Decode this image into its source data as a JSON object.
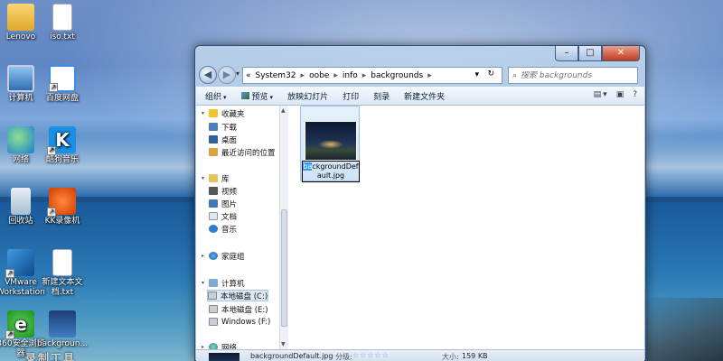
{
  "desktop": {
    "icons": [
      {
        "label": "Lenovo",
        "icon": "folder-icon"
      },
      {
        "label": "iso.txt",
        "icon": "text-file-icon"
      },
      {
        "label": "计算机",
        "icon": "computer-icon"
      },
      {
        "label": "百度网盘",
        "icon": "baidu-netdisk-icon"
      },
      {
        "label": "网络",
        "icon": "network-icon"
      },
      {
        "label": "酷狗音乐",
        "icon": "kugou-music-icon"
      },
      {
        "label": "回收站",
        "icon": "recycle-bin-icon"
      },
      {
        "label": "KK录像机",
        "icon": "kk-recorder-icon"
      },
      {
        "label": "VMware Workstation",
        "icon": "vmware-icon"
      },
      {
        "label": "新建文本文档.txt",
        "icon": "text-file-icon"
      },
      {
        "label": "360安全浏览器",
        "icon": "360-browser-icon"
      },
      {
        "label": "backgroun...",
        "icon": "image-file-icon"
      }
    ],
    "watermark": "录制工具"
  },
  "window": {
    "caption": {
      "minimize": "–",
      "maximize": "□",
      "close": "✕"
    },
    "nav": {
      "back": "◀",
      "forward": "▶",
      "dropdown": "▾"
    },
    "address": {
      "prefix": "«",
      "segments": [
        "System32",
        "oobe",
        "info",
        "backgrounds"
      ],
      "separator": "▸",
      "dropdown": "▾",
      "refresh": "↻"
    },
    "search": {
      "placeholder": "搜索 backgrounds",
      "icon": "⌕"
    },
    "toolbar": {
      "organize": "组织",
      "preview": "预览",
      "slideshow": "放映幻灯片",
      "print": "打印",
      "burn": "刻录",
      "new_folder": "新建文件夹",
      "arrow": "▾",
      "view_icon": "▤",
      "view_arrow": "▾",
      "preview_pane_icon": "▣",
      "help_icon": "?"
    },
    "navpane": {
      "favorites": {
        "label": "收藏夹",
        "items": [
          "下载",
          "桌面",
          "最近访问的位置"
        ]
      },
      "libraries": {
        "label": "库",
        "items": [
          "视频",
          "图片",
          "文档",
          "音乐"
        ]
      },
      "homegroup": {
        "label": "家庭组"
      },
      "computer": {
        "label": "计算机",
        "items": [
          "本地磁盘 (C:)",
          "本地磁盘 (E:)",
          "Windows (F:)"
        ]
      },
      "network": {
        "label": "网络"
      },
      "expand_arrow": "▾",
      "collapse_arrow": "▸",
      "scroll_up": "▲",
      "scroll_down": "▼"
    },
    "files": [
      {
        "name_selected_part": "ba",
        "name_rest": "ckgroundDefault.jpg",
        "selected": true
      }
    ],
    "details": {
      "name": "backgroundDefault.jpg",
      "rating_label": "分级:",
      "stars": "☆☆☆☆☆",
      "size_label": "大小:",
      "size": "159 KB"
    }
  },
  "colors": {
    "titlebar": "#b9d1ea",
    "selection": "#3399ff",
    "close_button": "#c33a1f"
  }
}
